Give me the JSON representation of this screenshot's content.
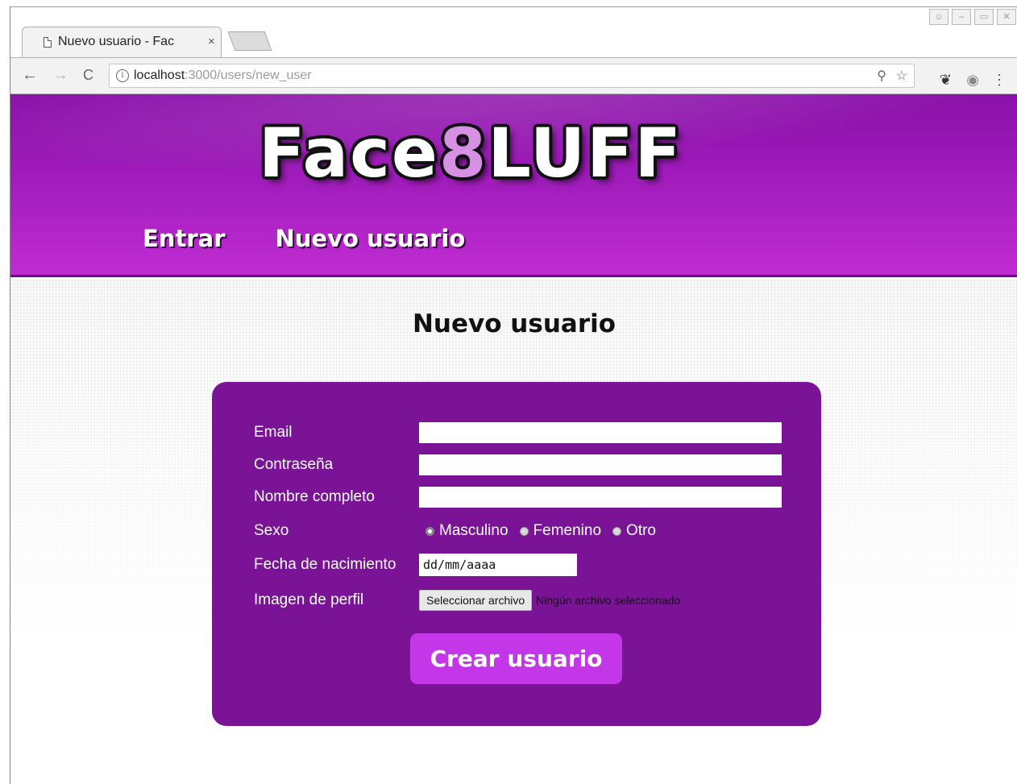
{
  "browser": {
    "tab": {
      "title": "Nuevo usuario - Fac",
      "close_glyph": "×"
    },
    "window_controls": [
      "☺",
      "–",
      "▭",
      "✕"
    ],
    "toolbar": {
      "url_host": "localhost",
      "url_path": ":3000/users/new_user",
      "back_glyph": "←",
      "forward_glyph": "→",
      "reload_glyph": "C",
      "info_glyph": "i"
    }
  },
  "header": {
    "logo_part1": "Face",
    "logo_accent": "8",
    "logo_part2": "LUFF",
    "nav": [
      "Entrar",
      "Nuevo usuario"
    ],
    "colors": {
      "primary": "#9d1ab9",
      "accent": "#d690e4"
    }
  },
  "main": {
    "heading": "Nuevo usuario",
    "form": {
      "email_label": "Email",
      "password_label": "Contraseña",
      "fullname_label": "Nombre completo",
      "gender_label": "Sexo",
      "gender_options": [
        "Masculino",
        "Femenino",
        "Otro"
      ],
      "gender_selected": "Masculino",
      "birthdate_label": "Fecha de nacimiento",
      "birthdate_placeholder": "dd/mm/aaaa",
      "avatar_label": "Imagen de perfil",
      "file_button": "Seleccionar archivo",
      "file_status": "Ningún archivo seleccionado",
      "submit": "Crear usuario",
      "card_color": "#7a1395",
      "button_color": "#c437e8"
    }
  }
}
